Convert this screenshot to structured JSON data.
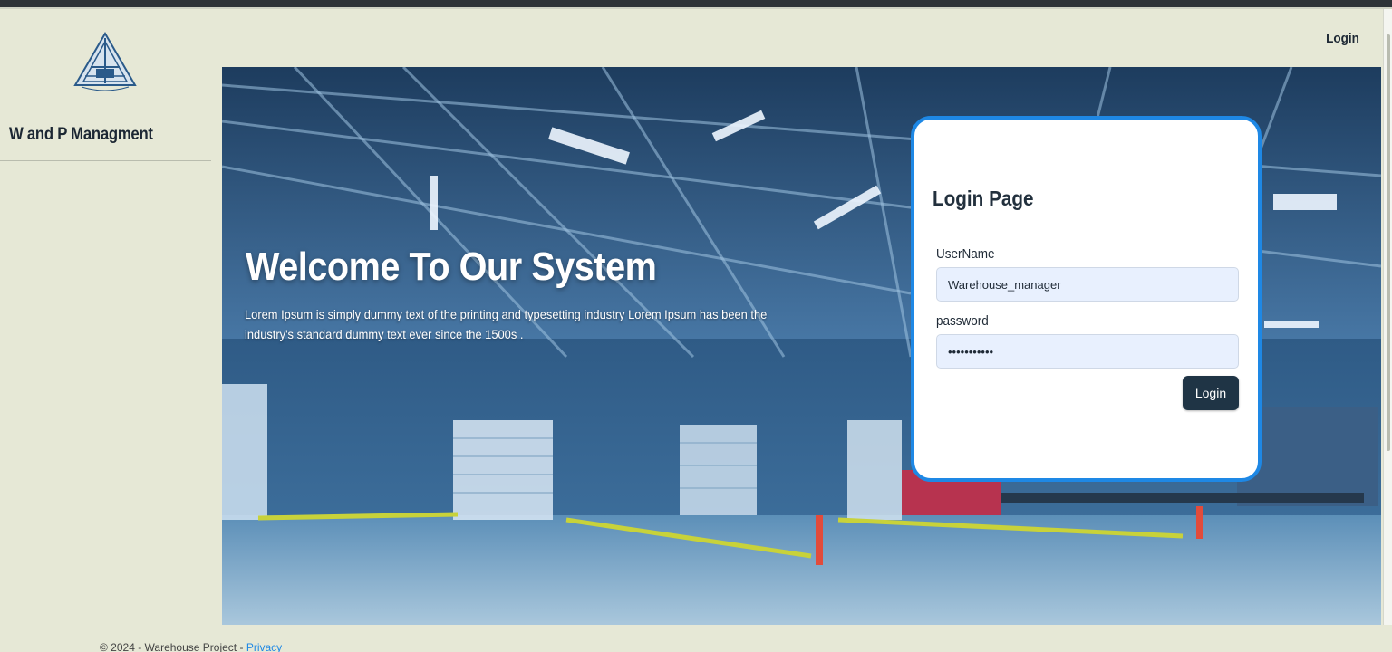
{
  "app": {
    "brand_name": "W and P Managment",
    "logo_icon": "triangle-emblem-logo"
  },
  "topnav": {
    "login_link": "Login"
  },
  "hero": {
    "title": "Welcome To Our System",
    "subtitle": "Lorem Ipsum is simply dummy text of the printing and typesetting industry Lorem Ipsum has been the industry's standard dummy text ever since the 1500s ."
  },
  "login_form": {
    "title": "Login Page",
    "username_label": "UserName",
    "username_value": "Warehouse_manager",
    "password_label": "password",
    "password_value": "warehouse12",
    "submit_label": "Login"
  },
  "footer": {
    "copyright": "© 2024 - Warehouse Project - ",
    "privacy_link": "Privacy"
  },
  "colors": {
    "sidebar_bg": "#e6e8d6",
    "card_border": "#1e88e5",
    "button_bg": "#1f3445",
    "input_bg": "#e8f0fe"
  }
}
